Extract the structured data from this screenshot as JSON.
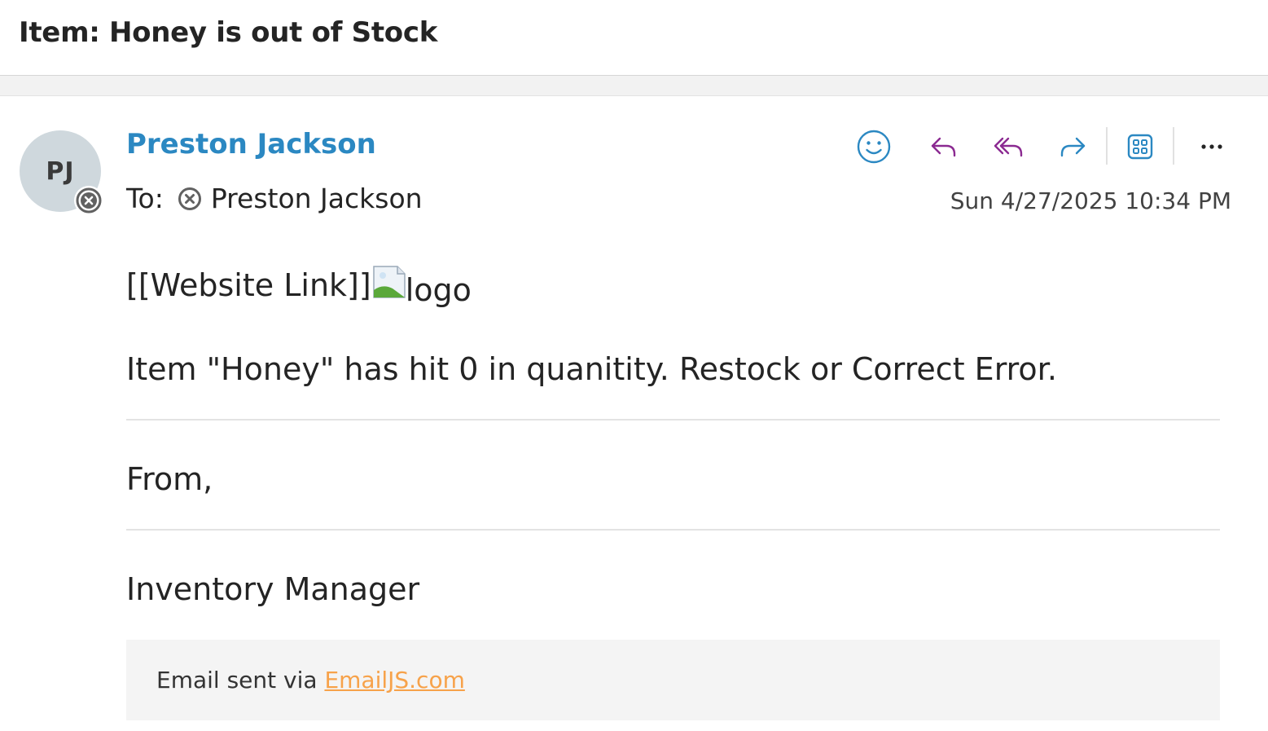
{
  "subject": "Item: Honey is out of Stock",
  "message": {
    "avatar_initials": "PJ",
    "sender_name": "Preston Jackson",
    "to_label": "To:",
    "recipient_name": "Preston Jackson",
    "datetime": "Sun 4/27/2025 10:34 PM"
  },
  "toolbar": {
    "icons": [
      "emoji-icon",
      "reply-icon",
      "reply-all-icon",
      "forward-icon",
      "apps-icon",
      "more-options-icon"
    ],
    "colors": {
      "emoji": "#2b88c2",
      "reply": "#8b2a91",
      "forward": "#2b88c2",
      "apps": "#2b88c2"
    }
  },
  "body": {
    "website_link_text": "[[Website Link]]",
    "logo_alt": "logo",
    "stock_message": "Item \"Honey\" has hit 0 in quanitity. Restock or Correct Error.",
    "closing": "From,",
    "signature": "Inventory Manager",
    "footer_prefix": "Email sent via ",
    "footer_link": "EmailJS.com"
  },
  "colors": {
    "sender": "#2b88c2",
    "link": "#f7a24a",
    "avatar_bg": "#cfd8dd"
  }
}
